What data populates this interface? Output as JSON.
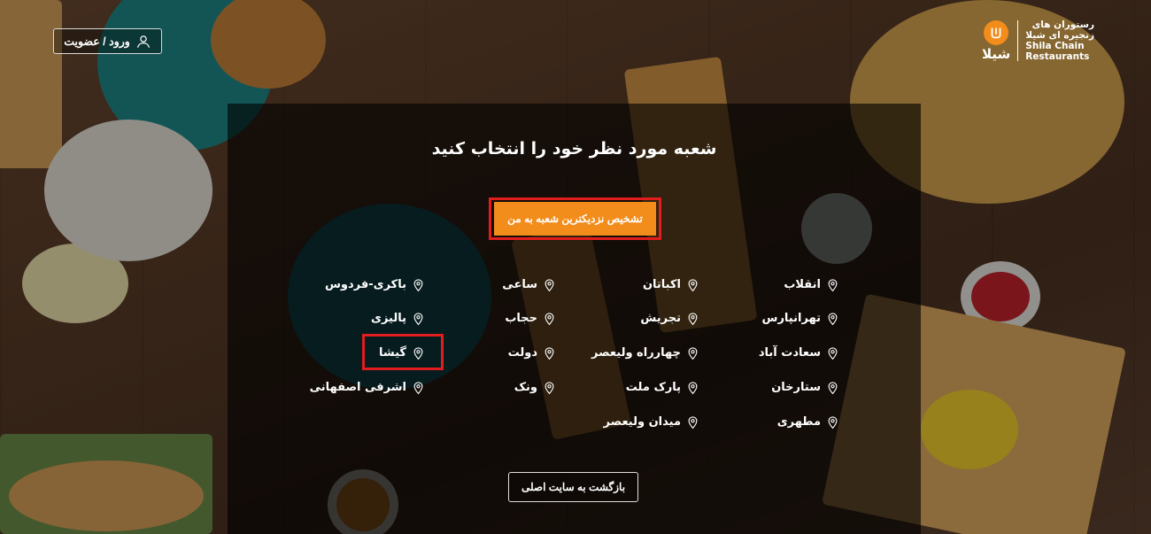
{
  "header": {
    "login_label": "ورود / عضویت",
    "logo": {
      "name_fa_line1": "رستوران های",
      "name_fa_line2": "زنجیره ای شیلا",
      "name_en_line1": "Shila Chain",
      "name_en_line2": "Restaurants",
      "wordmark": "شیلا"
    }
  },
  "main": {
    "title": "شعبه مورد نظر خود را انتخاب کنید",
    "nearest_button": "تشخیص نزدیکترین شعبه به من",
    "columns": [
      [
        "انقلاب",
        "تهرانپارس",
        "سعادت آباد",
        "ستارخان",
        "مطهری"
      ],
      [
        "اکباتان",
        "تجریش",
        "چهارراه ولیعصر",
        "پارک ملت",
        "میدان ولیعصر"
      ],
      [
        "ساعی",
        "حجاب",
        "دولت",
        "ونک"
      ],
      [
        "باکری-فردوس",
        "پالیزی",
        "گیشا",
        "اشرفی اصفهانی"
      ]
    ],
    "highlighted_branch": "گیشا",
    "back_button": "بازگشت به سایت اصلی"
  },
  "colors": {
    "accent": "#f28c1b",
    "highlight": "#e11d1d",
    "text": "#ffffff"
  },
  "icons": {
    "login": "user-icon",
    "branch": "map-pin-icon",
    "logo": "shila-logo-icon"
  }
}
